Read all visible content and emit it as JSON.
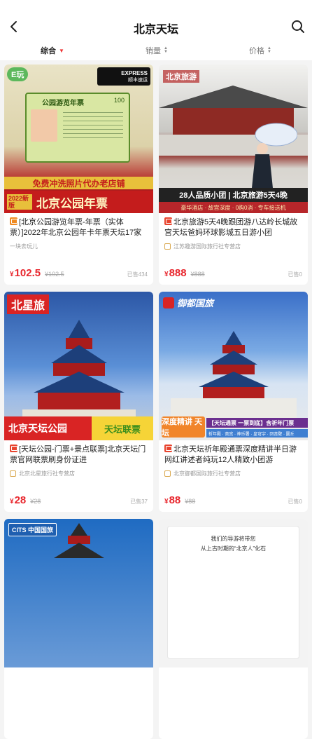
{
  "header": {
    "title": "北京天坛",
    "back_icon": "chevron-left-icon",
    "search_icon": "search-icon"
  },
  "sort": {
    "items": [
      {
        "label": "综合",
        "active": true
      },
      {
        "label": "销量",
        "active": false
      },
      {
        "label": "价格",
        "active": false
      }
    ]
  },
  "colors": {
    "price": "#e8262d",
    "accent": "#e8442e"
  },
  "products": [
    {
      "thumb": {
        "tag": "E玩",
        "express": "EXPRESS",
        "express_sub": "顺丰速运",
        "card_title": "公园游览年票",
        "card_num": "100",
        "promo": "免费冲洗照片代办老店铺",
        "year": "2022新版",
        "headline": "北京公园年票"
      },
      "title": "[北京公园游览年票-年票（实体票）]2022年北京公园年卡年票天坛17家",
      "shop": "一块去玩儿",
      "price": "102.5",
      "orig": "¥102.5",
      "sold": "已售434"
    },
    {
      "thumb": {
        "tag": "北京旅游",
        "headline": "28人品质小团 | 北京旅游5天4晚",
        "subline": "豪华酒店 · 故宫深度 · 0购0消 · 专车接送机"
      },
      "title": "北京旅游5天4晚跟团游八达岭长城故宫天坛爸妈环球影城五日游小团",
      "shop": "江苏趣游国际旅行社专营店",
      "price": "888",
      "orig": "¥888",
      "sold": "已售0"
    },
    {
      "thumb": {
        "brand": "北星旅",
        "headline": "北京天坛公园",
        "tag": "天坛联票"
      },
      "title": "[天坛公园-门票+景点联票]北京天坛门票官网联票刷身份证进",
      "shop": "北京北星旅行社专营店",
      "price": "28",
      "orig": "¥28",
      "sold": "已售37"
    },
    {
      "thumb": {
        "brand": "御都国旅",
        "tag": "深度精讲 天坛",
        "headline": "【天坛通票 一票到底】含祈年门票",
        "subline": "祈年殿 · 斋宫 · 神乐署 · 皇穹宇 · 回音壁 · 圜丘"
      },
      "title": "北京天坛祈年殿通票深度精讲半日游网红讲述者纯玩12人精致小团游",
      "shop": "北京御都国际旅行社专营店",
      "price": "88",
      "orig": "¥88",
      "sold": "已售0"
    },
    {
      "thumb": {
        "brand": "CITS 中国国旅"
      }
    },
    {
      "thumb": {
        "line1": "我们的导游将带您",
        "line2": "从上古时期的“北京人”化石"
      }
    }
  ]
}
